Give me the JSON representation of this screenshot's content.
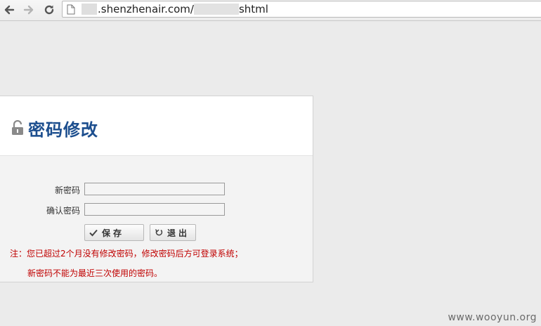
{
  "browser": {
    "back_icon": "back-arrow-icon",
    "forward_icon": "forward-arrow-icon",
    "reload_icon": "reload-icon",
    "url_host": ".shenzhenair.com/",
    "url_path": "shtml"
  },
  "panel": {
    "title": "密码修改",
    "lock_icon": "lock-icon",
    "new_password_label": "新密码",
    "confirm_password_label": "确认密码",
    "new_password_value": "",
    "confirm_password_value": "",
    "save_label": "保存",
    "exit_label": "退出",
    "notice_line1": "注：您已超过2个月没有修改密码，修改密码后方可登录系统；",
    "notice_line2": "新密码不能为最近三次使用的密码。"
  },
  "watermark": "www.wooyun.org",
  "colors": {
    "title": "#1c4e8e",
    "notice": "#c00000",
    "background": "#ebebeb"
  }
}
